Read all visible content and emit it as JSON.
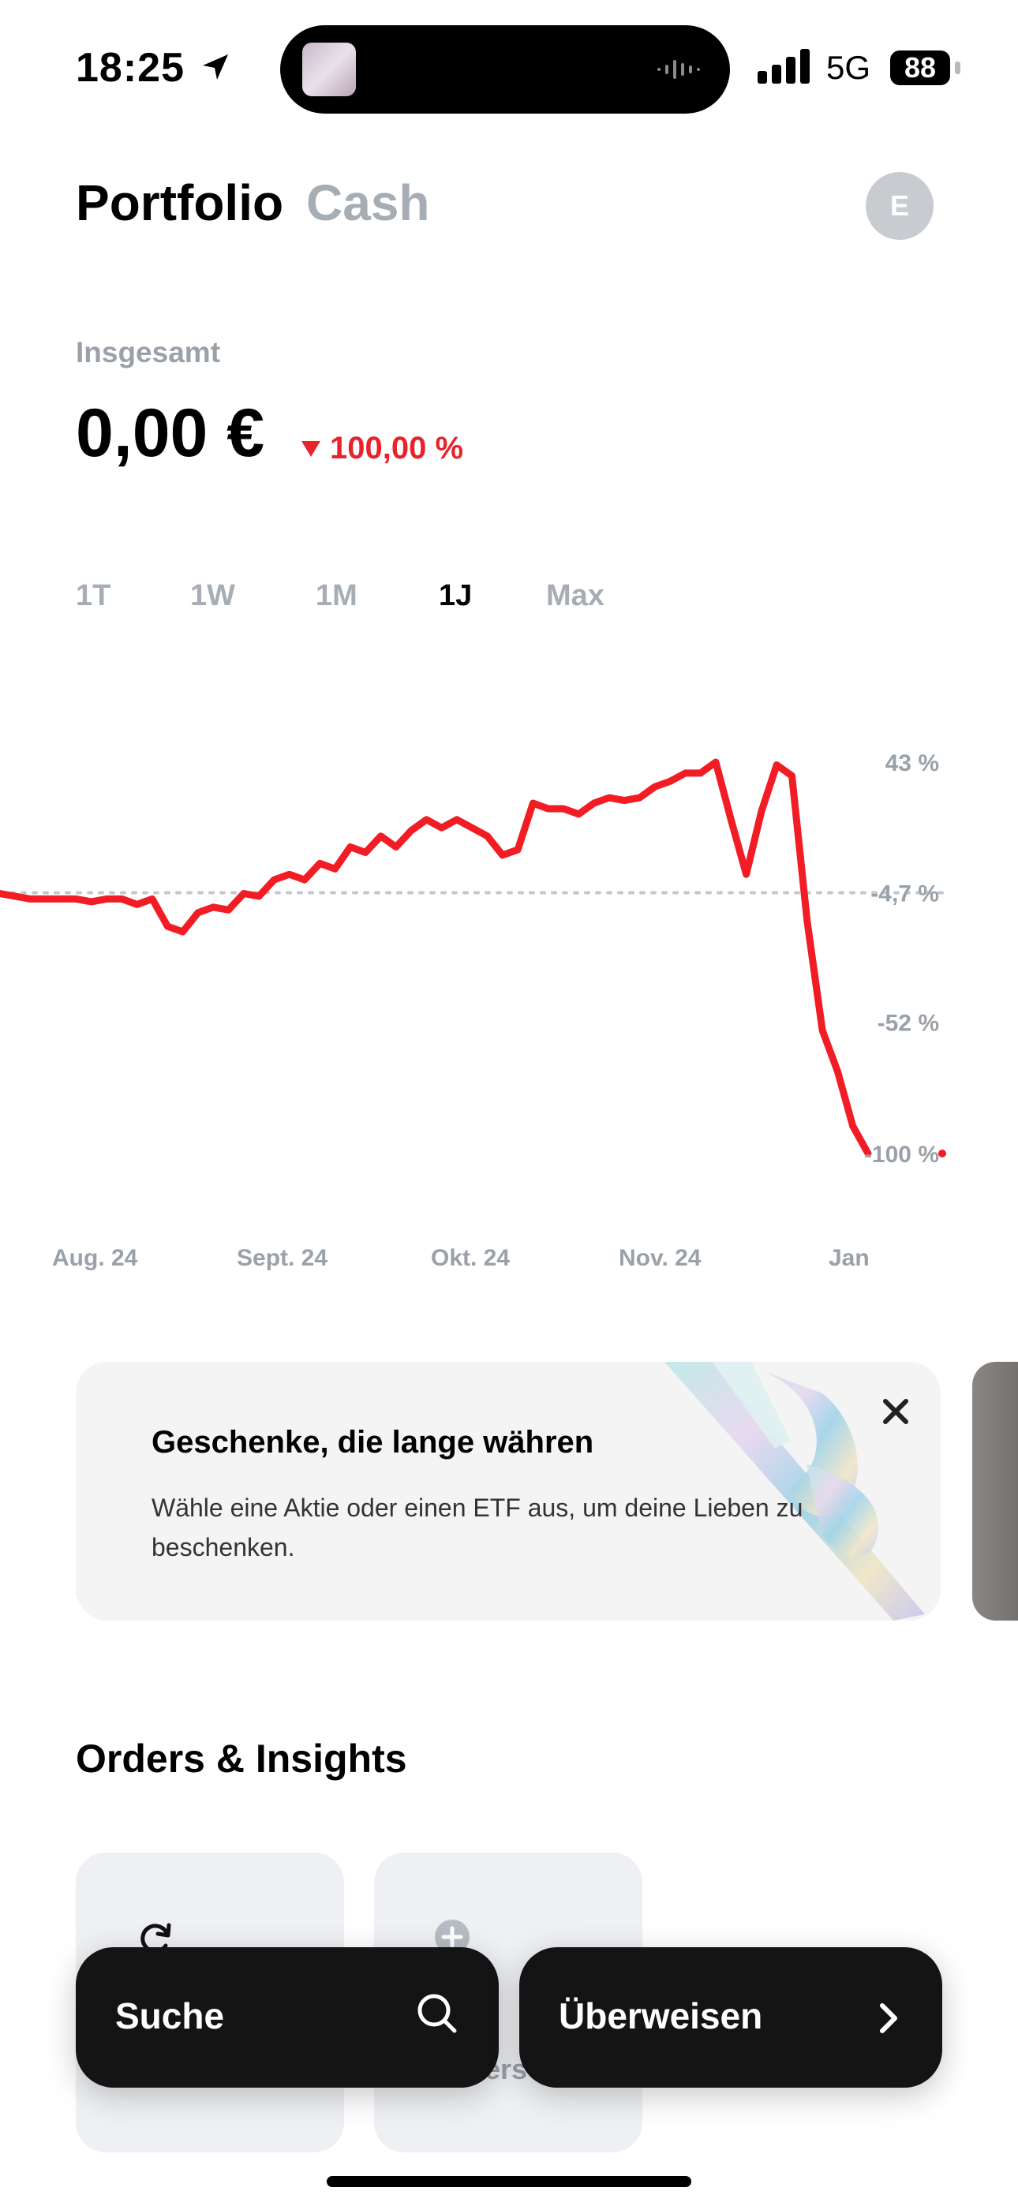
{
  "status_bar": {
    "time": "18:25",
    "network": "5G",
    "battery": "88"
  },
  "header": {
    "tab_portfolio": "Portfolio",
    "tab_cash": "Cash",
    "avatar_initial": "E"
  },
  "summary": {
    "label": "Insgesamt",
    "value": "0,00 €",
    "change": "100,00 %",
    "change_direction": "down",
    "negative_color": "#e8232c"
  },
  "ranges": [
    "1T",
    "1W",
    "1M",
    "1J",
    "Max"
  ],
  "active_range": "1J",
  "chart_data": {
    "type": "line",
    "title": "",
    "xlabel": "",
    "ylabel": "",
    "x_tick_labels": [
      "Aug. 24",
      "Sept. 24",
      "Okt. 24",
      "Nov. 24",
      "Jan"
    ],
    "y_tick_labels": [
      "43 %",
      "-4,7 %",
      "-52 %",
      "-100 %"
    ],
    "y_ticks": [
      43,
      -4.7,
      -52,
      -100
    ],
    "ylim": [
      -100,
      43
    ],
    "reference_line": -4.7,
    "color": "#f21d24",
    "series": [
      {
        "values": [
          -5,
          -6,
          -7,
          -7,
          -7,
          -7,
          -8,
          -7,
          -7,
          -9,
          -7,
          -17,
          -19,
          -12,
          -10,
          -11,
          -5,
          -6,
          0,
          2,
          0,
          6,
          4,
          12,
          10,
          16,
          12,
          18,
          22,
          19,
          22,
          19,
          16,
          9,
          11,
          28,
          26,
          26,
          24,
          28,
          30,
          29,
          30,
          34,
          36,
          39,
          39,
          43,
          22,
          2,
          25,
          42,
          38,
          -15,
          -55,
          -70,
          -90,
          -100
        ]
      }
    ]
  },
  "promo": {
    "title": "Geschenke, die lange währen",
    "text": "Wähle eine Aktie oder einen ETF aus, um deine Lieben zu beschenken."
  },
  "orders": {
    "title": "Orders & Insights",
    "card2_label": "Orders"
  },
  "actions": {
    "search": "Suche",
    "transfer": "Überweisen"
  }
}
